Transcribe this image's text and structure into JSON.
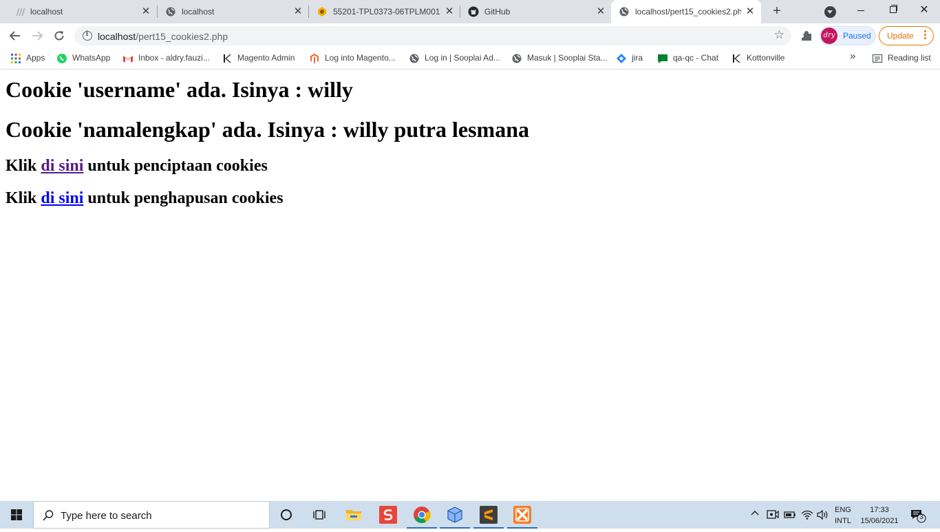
{
  "tabs": [
    {
      "title": "localhost",
      "icon": "hierarchy-icon"
    },
    {
      "title": "localhost",
      "icon": "globe-icon"
    },
    {
      "title": "55201-TPL0373-06TPLM001-",
      "icon": "moodle-icon"
    },
    {
      "title": "GitHub",
      "icon": "github-icon"
    },
    {
      "title": "localhost/pert15_cookies2.php",
      "icon": "globe-icon",
      "active": true
    }
  ],
  "tab_close_glyph": "✕",
  "new_tab_glyph": "+",
  "window": {
    "close_glyph": "✕"
  },
  "address": {
    "host": "localhost",
    "path": "/pert15_cookies2.php"
  },
  "star_glyph": "☆",
  "profile": {
    "initials": "dry",
    "status": "Paused"
  },
  "update_label": "Update",
  "bookmarks": [
    {
      "label": "Apps",
      "icon": "apps-grid-icon"
    },
    {
      "label": "WhatsApp",
      "icon": "whatsapp-icon"
    },
    {
      "label": "Inbox - aldry.fauzi...",
      "icon": "gmail-icon"
    },
    {
      "label": "Magento Admin",
      "icon": "k-logo-icon"
    },
    {
      "label": "Log into Magento...",
      "icon": "magento-icon"
    },
    {
      "label": "Log in | Sooplai Ad...",
      "icon": "globe-icon"
    },
    {
      "label": "Masuk | Sooplai Sta...",
      "icon": "globe-icon"
    },
    {
      "label": "jira",
      "icon": "jira-icon"
    },
    {
      "label": "qa-qc - Chat",
      "icon": "chat-icon"
    },
    {
      "label": "Kottonville",
      "icon": "k-logo-icon"
    }
  ],
  "bookmarks_overflow": "»",
  "reading_list": "Reading list",
  "page": {
    "heading1": "Cookie 'username' ada. Isinya : willy",
    "heading2": "Cookie 'namalengkap' ada. Isinya : willy putra lesmana",
    "line1_prefix": "Klik ",
    "line1_link": "di sini",
    "line1_suffix": " untuk penciptaan cookies",
    "line2_prefix": "Klik ",
    "line2_link": "di sini",
    "line2_suffix": " untuk penghapusan cookies"
  },
  "taskbar": {
    "search_placeholder": "Type here to search",
    "apps": [
      "cortana-icon",
      "task-view-icon",
      "file-explorer-icon",
      "sublime-s-icon",
      "chrome-icon",
      "virtualbox-icon",
      "sublime-text-icon",
      "xampp-icon"
    ],
    "lang_line1": "ENG",
    "lang_line2": "INTL",
    "time": "17:33",
    "date": "15/06/2021",
    "notification_count": "3",
    "tray_chevron": "^"
  },
  "colors": {
    "tabstrip": "#dee1e6",
    "visited_link": "#551a8b",
    "unvisited_link": "#0000ee",
    "update_accent": "#e37400",
    "profile_accent": "#1a73e8",
    "taskbar": "#cfdeec"
  }
}
